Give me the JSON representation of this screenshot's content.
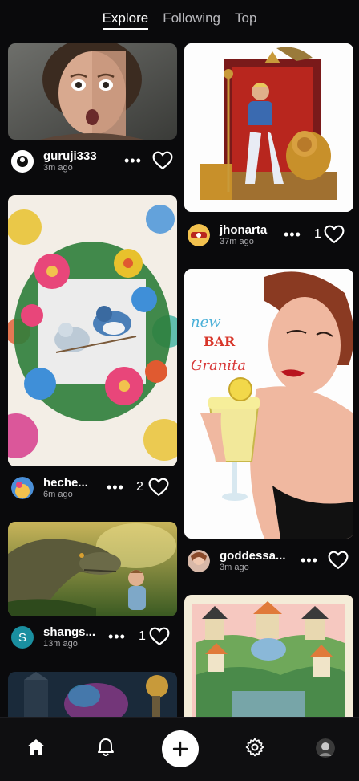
{
  "tabs": [
    "Explore",
    "Following",
    "Top"
  ],
  "active_tab": "Explore",
  "posts": [
    {
      "username": "guruji333",
      "time": "3m ago",
      "likes": "",
      "avatar_icon": "guruji-avatar"
    },
    {
      "username": "heche...",
      "time": "6m ago",
      "likes": "2",
      "avatar_icon": "floral-avatar"
    },
    {
      "username": "shangs...",
      "time": "13m ago",
      "likes": "1",
      "avatar_letter": "S"
    },
    {
      "username": "jhonarta",
      "time": "37m ago",
      "likes": "1",
      "avatar_icon": "badge-avatar"
    },
    {
      "username": "goddessa...",
      "time": "3m ago",
      "likes": "",
      "avatar_icon": "portrait-avatar"
    }
  ],
  "artwork_text": {
    "neon_sign": [
      "new",
      "BAR",
      "Granita"
    ]
  },
  "nav": {
    "home": "home-icon",
    "notifications": "bell-icon",
    "create": "plus-icon",
    "settings": "gear-icon",
    "profile": "profile-avatar"
  },
  "colors": {
    "background": "#0a0a0c",
    "accent": "#ffffff",
    "avatar_s": "#1a8fa0"
  }
}
